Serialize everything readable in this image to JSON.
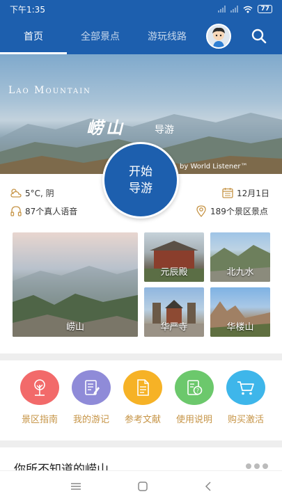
{
  "status": {
    "time": "下午1:35",
    "battery": "77"
  },
  "nav": {
    "tabs": [
      {
        "label": "首页"
      },
      {
        "label": "全部景点"
      },
      {
        "label": "游玩线路"
      }
    ]
  },
  "banner": {
    "title_en": "Lao Mountain",
    "title_cn": "崂山",
    "subtitle": "导游",
    "credit": "by World Listener™"
  },
  "start_button": {
    "line1": "开始",
    "line2": "导游"
  },
  "info": {
    "weather": "5°C, 阴",
    "date": "12月1日",
    "voices": "87个真人语音",
    "spots": "189个景区景点"
  },
  "sites": [
    {
      "label": "崂山"
    },
    {
      "label": "元辰殿"
    },
    {
      "label": "北九水"
    },
    {
      "label": "华严寺"
    },
    {
      "label": "华楼山"
    }
  ],
  "menu": [
    {
      "label": "景区指南",
      "color": "#f26a6a",
      "icon": "tree-icon"
    },
    {
      "label": "我的游记",
      "color": "#8f8bd8",
      "icon": "notebook-icon"
    },
    {
      "label": "参考文献",
      "color": "#f6b226",
      "icon": "document-icon"
    },
    {
      "label": "使用说明",
      "color": "#6cc86c",
      "icon": "help-document-icon"
    },
    {
      "label": "购买激活",
      "color": "#3eb6ea",
      "icon": "cart-icon"
    }
  ],
  "section": {
    "title": "你所不知道的崂山"
  },
  "colors": {
    "primary": "#1d5fae",
    "accent": "#c69446"
  }
}
